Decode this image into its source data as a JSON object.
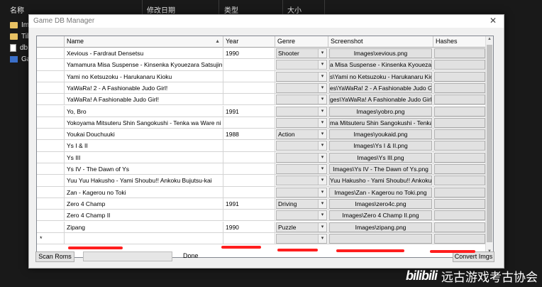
{
  "explorer": {
    "columns": [
      "名称",
      "修改日期",
      "类型",
      "大小"
    ],
    "items": [
      {
        "icon": "folder-icon",
        "label": "Im"
      },
      {
        "icon": "folder-icon",
        "label": "Til"
      },
      {
        "icon": "file-icon",
        "label": "db"
      },
      {
        "icon": "app-icon",
        "label": "Ga"
      }
    ]
  },
  "window": {
    "title": "Game DB Manager",
    "close_glyph": "✕"
  },
  "grid": {
    "columns": [
      "Name",
      "Year",
      "Genre",
      "Screenshot",
      "Hashes"
    ],
    "sort_glyph": "▲",
    "dropdown_glyph": "▾",
    "new_row_marker": "*",
    "rows": [
      {
        "name": "Xevious - Fardraut Densetsu",
        "year": "1990",
        "genre": "Shooter",
        "screenshot": "Images\\xevious.png"
      },
      {
        "name": "Yamamura Misa Suspense - Kinsenka Kyouezara Satsujin Ji...",
        "year": "",
        "genre": "",
        "screenshot": "a Misa Suspense - Kinsenka Kyouezara S"
      },
      {
        "name": "Yami no Ketsuzoku - Harukanaru Kioku",
        "year": "",
        "genre": "",
        "screenshot": "s\\Yami no Ketsuzoku - Harukanaru Kioku"
      },
      {
        "name": "YaWaRa! 2 - A Fashionable Judo Girl!",
        "year": "",
        "genre": "",
        "screenshot": "es\\YaWaRa! 2 - A Fashionable Judo Girl!"
      },
      {
        "name": "YaWaRa! A Fashionable Judo Girl!",
        "year": "",
        "genre": "",
        "screenshot": "ges\\YaWaRa! A Fashionable Judo Girl!.p"
      },
      {
        "name": "Yo, Bro",
        "year": "1991",
        "genre": "",
        "screenshot": "Images\\yobro.png"
      },
      {
        "name": "Yokoyama Mitsuteru Shin Sangokushi - Tenka wa Ware ni",
        "year": "",
        "genre": "",
        "screenshot": "ma Mitsuteru Shin Sangokushi - Tenka w"
      },
      {
        "name": "Youkai Douchuuki",
        "year": "1988",
        "genre": "Action",
        "screenshot": "Images\\youkaid.png"
      },
      {
        "name": "Ys I & II",
        "year": "",
        "genre": "",
        "screenshot": "Images\\Ys I & II.png"
      },
      {
        "name": "Ys III",
        "year": "",
        "genre": "",
        "screenshot": "Images\\Ys III.png"
      },
      {
        "name": "Ys IV - The Dawn of Ys",
        "year": "",
        "genre": "",
        "screenshot": "Images\\Ys IV - The Dawn of Ys.png"
      },
      {
        "name": "Yuu Yuu Hakusho - Yami Shoubu!! Ankoku Bujutsu-kai",
        "year": "",
        "genre": "",
        "screenshot": "Yuu Hakusho - Yami Shoubu!! Ankoku Bu"
      },
      {
        "name": "Zan - Kagerou no Toki",
        "year": "",
        "genre": "",
        "screenshot": "Images\\Zan - Kagerou no Toki.png"
      },
      {
        "name": "Zero 4 Champ",
        "year": "1991",
        "genre": "Driving",
        "screenshot": "Images\\zero4c.png"
      },
      {
        "name": "Zero 4 Champ II",
        "year": "",
        "genre": "",
        "screenshot": "Images\\Zero 4 Champ II.png"
      },
      {
        "name": "Zipang",
        "year": "1990",
        "genre": "Puzzle",
        "screenshot": "Images\\zipang.png"
      }
    ]
  },
  "footer": {
    "scan_label": "Scan Roms",
    "status": "Done",
    "convert_label": "Convert Imgs"
  },
  "watermark": {
    "logo": "bilibili",
    "text": "远古游戏考古协会"
  }
}
